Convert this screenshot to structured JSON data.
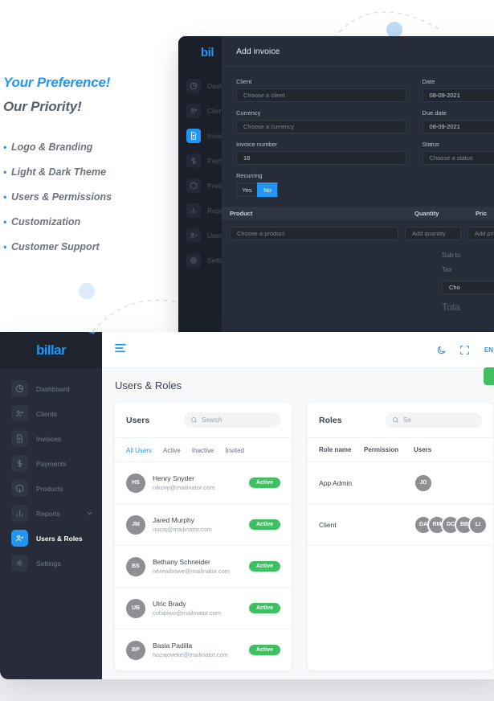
{
  "promo": {
    "headline_1": "Your Preference!",
    "headline_2": "Our Priority!",
    "bullets": [
      "Logo & Branding",
      "Light & Dark Theme",
      "Users & Permissions",
      "Customization",
      "Customer Support"
    ]
  },
  "invoice_window": {
    "brand": "bil",
    "modal_title": "Add invoice",
    "sidebar_items": [
      {
        "label": "Dashb",
        "icon": "dashboard-icon"
      },
      {
        "label": "Client",
        "icon": "clients-icon"
      },
      {
        "label": "Invoic",
        "icon": "invoices-icon"
      },
      {
        "label": "Paym",
        "icon": "payments-icon"
      },
      {
        "label": "Produ",
        "icon": "products-icon"
      },
      {
        "label": "Repor",
        "icon": "reports-icon"
      },
      {
        "label": "Users",
        "icon": "users-icon"
      },
      {
        "label": "Settin",
        "icon": "settings-icon"
      }
    ],
    "fields": {
      "client_label": "Client",
      "client_placeholder": "Choose a client",
      "currency_label": "Currency",
      "currency_placeholder": "Choose a currency",
      "invoice_number_label": "Invoice number",
      "invoice_number_value": "16",
      "date_label": "Date",
      "date_value": "08-09-2021",
      "due_date_label": "Due date",
      "due_date_value": "08-09-2021",
      "status_label": "Status",
      "status_placeholder": "Choose a status",
      "recurring_label": "Recurring",
      "recurring_yes": "Yes",
      "recurring_no": "No"
    },
    "table": {
      "headers": [
        "Product",
        "Quantity",
        "Pric"
      ],
      "row": {
        "product_placeholder": "Choose a product",
        "quantity_placeholder": "Add quantity",
        "price_placeholder": "Add price"
      }
    },
    "totals": {
      "sub_total_label": "Sub to",
      "tax_label": "Tax",
      "tax_select": "Cho",
      "total_label": "Tota"
    }
  },
  "app_window": {
    "brand": "billar",
    "sidebar_items": [
      {
        "label": "Dashboard",
        "icon": "dashboard-icon",
        "active": false
      },
      {
        "label": "Clients",
        "icon": "clients-icon",
        "active": false
      },
      {
        "label": "Invoices",
        "icon": "invoices-icon",
        "active": false
      },
      {
        "label": "Payments",
        "icon": "payments-icon",
        "active": false
      },
      {
        "label": "Products",
        "icon": "products-icon",
        "active": false
      },
      {
        "label": "Reports",
        "icon": "reports-icon",
        "active": false
      },
      {
        "label": "Users & Roles",
        "icon": "users-icon",
        "active": true
      },
      {
        "label": "Settings",
        "icon": "settings-icon",
        "active": false
      }
    ],
    "topbar": {
      "menu_icon": "hamburger-icon",
      "theme_icon": "moon-icon",
      "fullscreen_icon": "fullscreen-icon",
      "language": "EN"
    },
    "page_title": "Users & Roles",
    "users_card": {
      "title": "Users",
      "search_placeholder": "Search",
      "tabs": [
        {
          "label": "All Users",
          "active": true
        },
        {
          "label": "Active",
          "active": false
        },
        {
          "label": "Inactive",
          "active": false
        },
        {
          "label": "Invited",
          "active": false
        }
      ],
      "rows": [
        {
          "initials": "HS",
          "name": "Henry Snyder",
          "email": "nikuvy@mailinator.com",
          "status": "Active"
        },
        {
          "initials": "JM",
          "name": "Jared Murphy",
          "email": "nuciq@mailinator.com",
          "status": "Active"
        },
        {
          "initials": "BS",
          "name": "Bethany Schneider",
          "email": "nerewibowe@mailinator.com",
          "status": "Active"
        },
        {
          "initials": "UB",
          "name": "Ulric Brady",
          "email": "cohipiwo@mailinator.com",
          "status": "Active"
        },
        {
          "initials": "BP",
          "name": "Basia Padilla",
          "email": "hozajoveke@mailinator.com",
          "status": "Active"
        }
      ]
    },
    "roles_card": {
      "title": "Roles",
      "search_placeholder": "Se",
      "headers": [
        "Role name",
        "Permission",
        "Users"
      ],
      "rows": [
        {
          "role_name": "App Admin",
          "permission": "",
          "avatars": [
            "JD"
          ]
        },
        {
          "role_name": "Client",
          "permission": "",
          "avatars": [
            "GA",
            "RM",
            "DC",
            "BB",
            "LI"
          ]
        }
      ]
    }
  },
  "colors": {
    "accent_blue": "#2196f3",
    "status_green": "#3fbf62",
    "dark_panel": "#262c38",
    "dark_sidebar": "#272c38"
  }
}
